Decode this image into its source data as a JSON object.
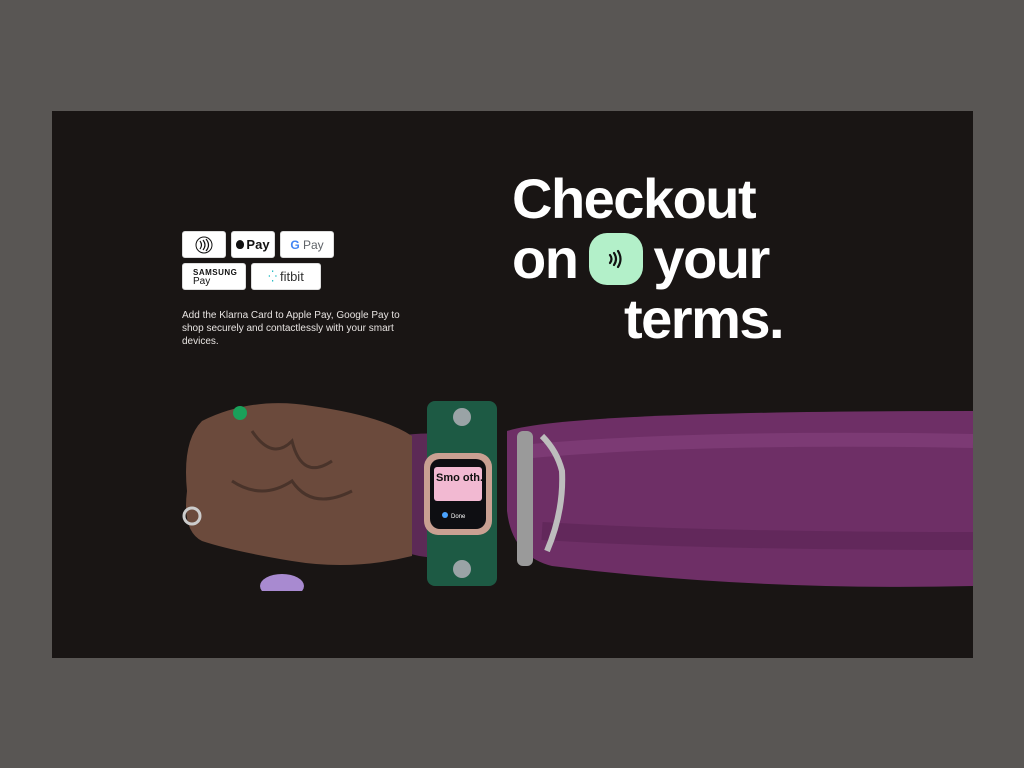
{
  "payment_badges": {
    "apple_pay": "Pay",
    "google_pay": "Pay",
    "google_g": "G",
    "samsung_line1": "SAMSUNG",
    "samsung_line2": "Pay",
    "fitbit": "fitbit"
  },
  "description": "Add the Klarna Card to Apple Pay, Google Pay to shop securely and contactlessly with your smart devices.",
  "headline": {
    "line1": "Checkout",
    "line2_start": "on",
    "line2_end": "your",
    "line3": "terms."
  },
  "watch_screen": {
    "text": "Smo oth.",
    "button": "Done"
  },
  "colors": {
    "background": "#595654",
    "card": "#191514",
    "accent": "#b3f0c9",
    "sleeve": "#6e2f66"
  },
  "icons": {
    "contactless": "contactless-icon",
    "klarna": "klarna-contactless-icon"
  }
}
